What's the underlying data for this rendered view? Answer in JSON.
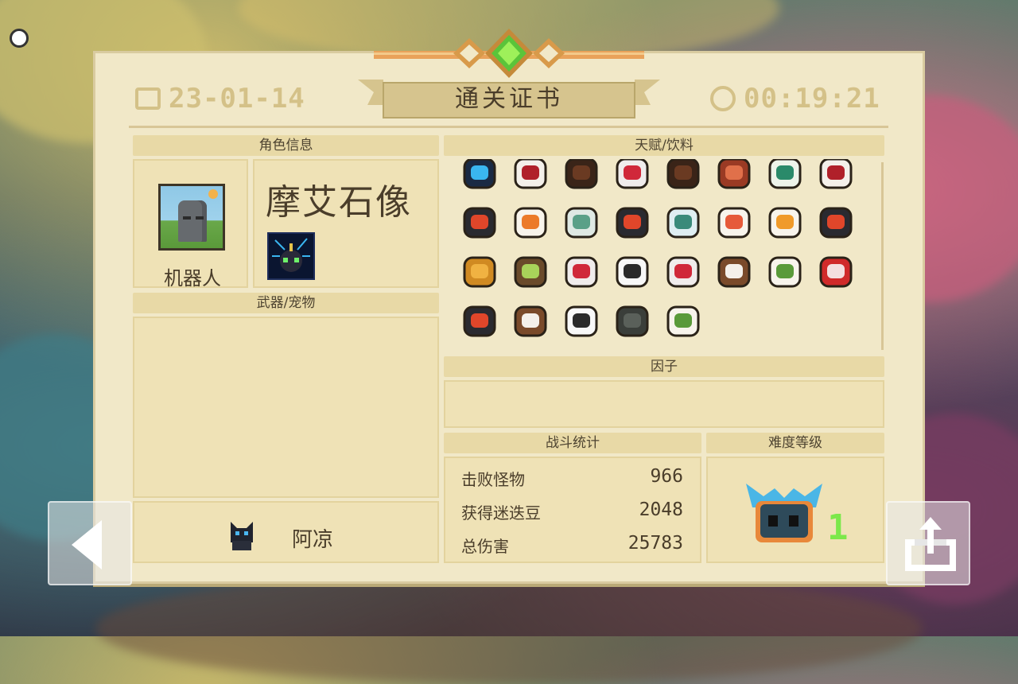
{
  "header": {
    "date": "23-01-14",
    "title": "通关证书",
    "time": "00:19:21"
  },
  "sections": {
    "character_info": "角色信息",
    "talents_drinks": "天赋/饮料",
    "weapons_pets": "武器/宠物",
    "factors": "因子",
    "battle_stats": "战斗统计",
    "difficulty": "难度等级"
  },
  "character": {
    "name": "机器人",
    "skin_name": "摩艾石像"
  },
  "talent_icons": [
    "crystal-shard-icon",
    "red-wine-icon",
    "clay-pot-icon",
    "red-drink-icon",
    "clay-pot-icon",
    "roast-meat-icon",
    "green-cup-icon",
    "red-wine-icon",
    "spicy-dish-icon",
    "orange-dish-icon",
    "soup-bowl-icon",
    "spicy-dish-icon",
    "milk-bottle-icon",
    "salad-plate-icon",
    "cake-plate-icon",
    "spicy-dish-icon",
    "golden-teapot-icon",
    "green-coconut-icon",
    "red-drink-icon",
    "milk-carton-icon",
    "red-drink-icon",
    "coconut-drink-icon",
    "veggie-plate-icon",
    "red-bun-icon",
    "spicy-dish-icon",
    "coconut-drink-icon",
    "milk-carton-icon",
    "dark-shell-icon",
    "veggie-plate-icon"
  ],
  "stats": [
    {
      "label": "击败怪物",
      "value": "966"
    },
    {
      "label": "获得迷迭豆",
      "value": "2048"
    },
    {
      "label": "总伤害",
      "value": "25783"
    }
  ],
  "difficulty_level": "1",
  "pet": {
    "name": "阿凉"
  },
  "colors": {
    "paper": "#f1e8c8",
    "header_band": "#e8d9a6",
    "text": "#4a3d2a",
    "faint_text": "#d4c188",
    "difficulty_green": "#7ce84a"
  }
}
